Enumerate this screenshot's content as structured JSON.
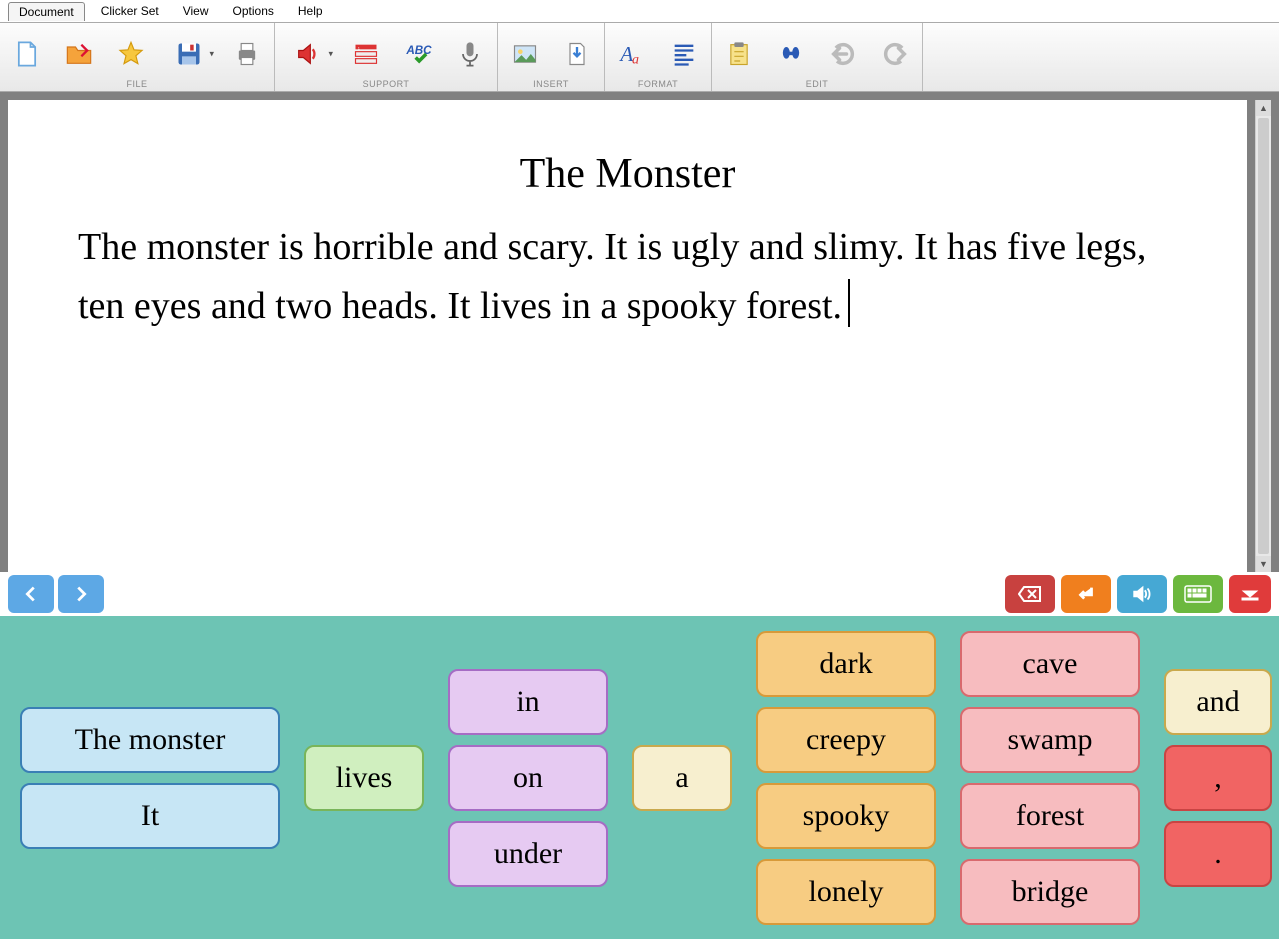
{
  "menu": {
    "tab": "Document",
    "items": [
      "Clicker Set",
      "View",
      "Options",
      "Help"
    ]
  },
  "toolbar_groups": [
    "FILE",
    "SUPPORT",
    "INSERT",
    "FORMAT",
    "EDIT"
  ],
  "document": {
    "title": "The Monster",
    "body": "The monster is horrible and scary. It is ugly and slimy. It has five legs, ten eyes and two heads. It lives in a spooky forest."
  },
  "clicker": {
    "col_subjects": [
      "The monster",
      "It"
    ],
    "col_verb": "lives",
    "col_preps": [
      "in",
      "on",
      "under"
    ],
    "col_article": "a",
    "col_adj": [
      "dark",
      "creepy",
      "spooky",
      "lonely"
    ],
    "col_noun": [
      "cave",
      "swamp",
      "forest",
      "bridge"
    ],
    "col_punc": [
      "and",
      ",",
      "."
    ]
  }
}
